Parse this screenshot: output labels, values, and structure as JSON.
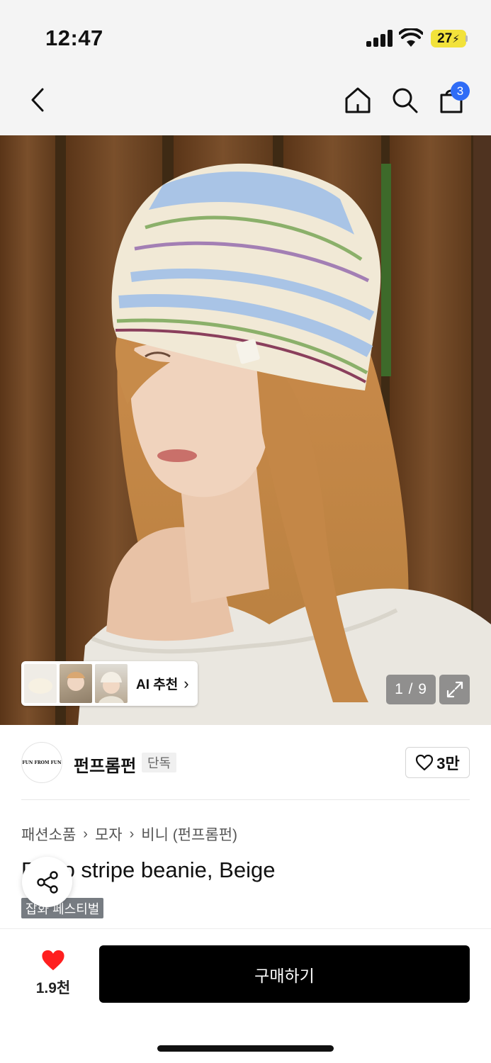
{
  "status": {
    "time": "12:47",
    "battery": "27"
  },
  "nav": {
    "cart_count": "3"
  },
  "gallery": {
    "ai_label": "AI 추천",
    "counter": "1 / 9"
  },
  "brand": {
    "logo_text": "FUN FROM FUN",
    "name": "펀프롬펀",
    "tag": "단독",
    "likes": "3만"
  },
  "breadcrumb": [
    "패션소품",
    "모자",
    "비니 (펀프롬펀)"
  ],
  "product": {
    "title": "Retro stripe beanie, Beige",
    "event_tag": "잡화 페스티벌"
  },
  "bottom": {
    "wish_count": "1.9천",
    "buy_label": "구매하기"
  },
  "colors": {
    "badge": "#2f6cf6",
    "heart": "#ff1f1f",
    "buy": "#000000",
    "battery": "#f2e23a"
  },
  "icons": [
    "back-arrow-icon",
    "home-icon",
    "search-icon",
    "shopping-bag-icon",
    "expand-icon",
    "heart-outline-icon",
    "share-icon",
    "heart-filled-icon",
    "chevron-right-icon"
  ]
}
